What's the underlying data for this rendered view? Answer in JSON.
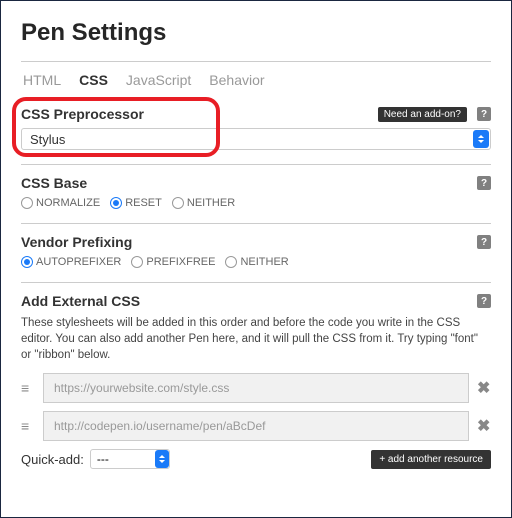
{
  "title": "Pen Settings",
  "tabs": [
    {
      "label": "HTML"
    },
    {
      "label": "CSS",
      "active": true
    },
    {
      "label": "JavaScript"
    },
    {
      "label": "Behavior"
    }
  ],
  "preprocessor": {
    "title": "CSS Preprocessor",
    "addon_badge": "Need an add-on?",
    "selected": "Stylus"
  },
  "base": {
    "title": "CSS Base",
    "options": [
      {
        "label": "NORMALIZE",
        "checked": false
      },
      {
        "label": "RESET",
        "checked": true
      },
      {
        "label": "NEITHER",
        "checked": false
      }
    ]
  },
  "vendor": {
    "title": "Vendor Prefixing",
    "options": [
      {
        "label": "AUTOPREFIXER",
        "checked": true
      },
      {
        "label": "PREFIXFREE",
        "checked": false
      },
      {
        "label": "NEITHER",
        "checked": false
      }
    ]
  },
  "external": {
    "title": "Add External CSS",
    "description": "These stylesheets will be added in this order and before the code you write in the CSS editor. You can also add another Pen here, and it will pull the CSS from it. Try typing \"font\" or \"ribbon\" below.",
    "resources": [
      {
        "placeholder": "https://yourwebsite.com/style.css"
      },
      {
        "placeholder": "http://codepen.io/username/pen/aBcDef"
      }
    ],
    "quick_add_label": "Quick-add:",
    "quick_add_selected": "---",
    "add_button": "+ add another resource"
  },
  "help_glyph": "?"
}
